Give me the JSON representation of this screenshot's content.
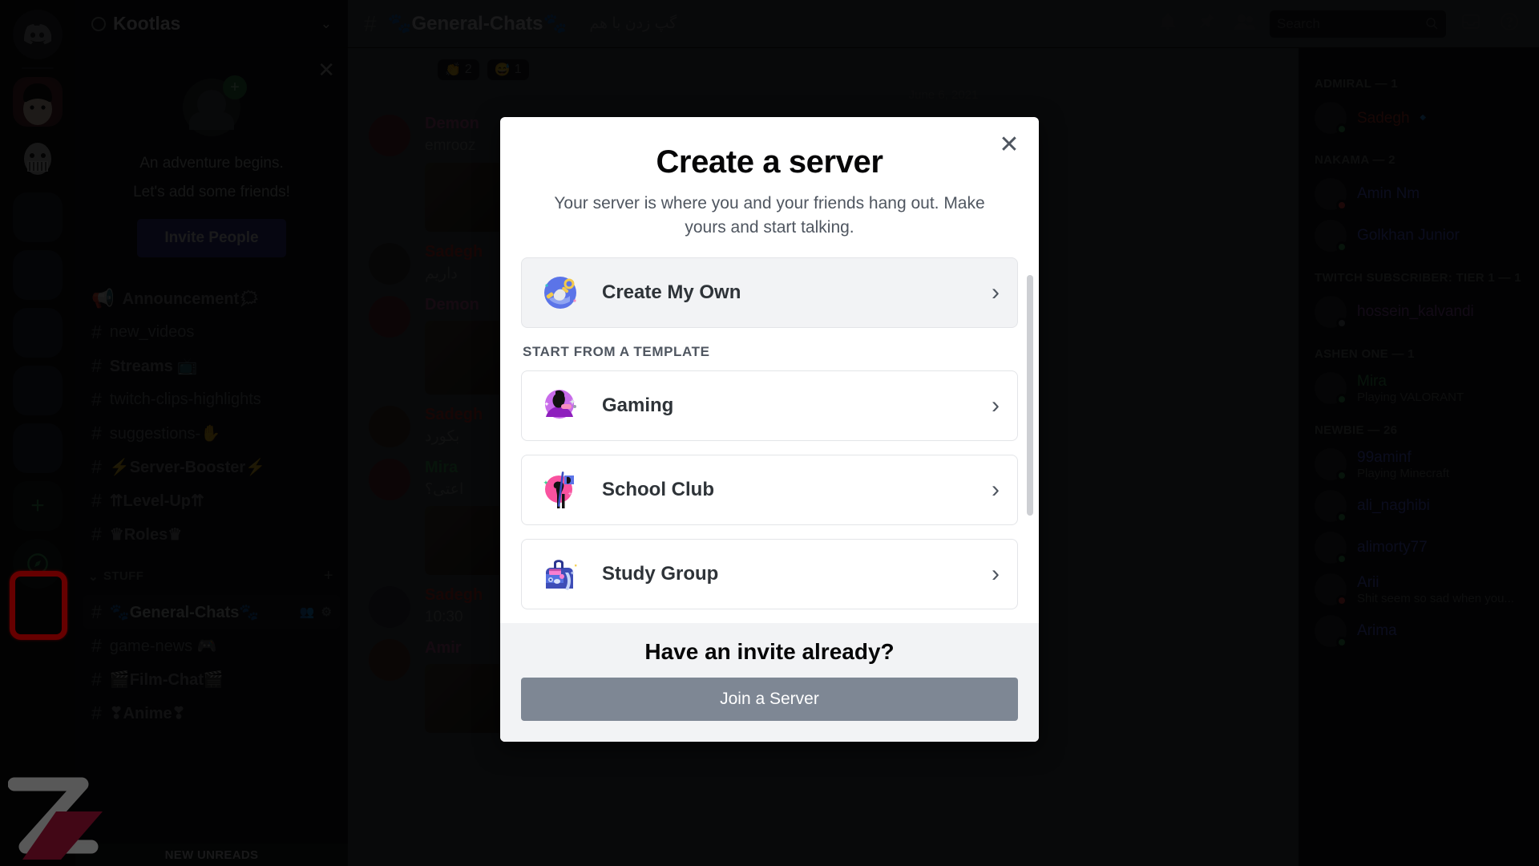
{
  "server": {
    "name": "Kootlas",
    "chevron": "⌄"
  },
  "friend_promo": {
    "line1": "An adventure begins.",
    "line2": "Let's add some friends!",
    "button": "Invite People",
    "close": "✕"
  },
  "channels": {
    "items": [
      {
        "icon": "📢",
        "name": "Announcement🗯",
        "bold": true,
        "active": false
      },
      {
        "icon": "#",
        "name": "new_videos",
        "bold": false,
        "active": false
      },
      {
        "icon": "#",
        "name": "Streams 📺",
        "bold": true,
        "active": false
      },
      {
        "icon": "#",
        "name": "twitch-clips-highlights",
        "bold": false,
        "active": false
      },
      {
        "icon": "#",
        "name": "suggestions-✋",
        "bold": false,
        "active": false
      },
      {
        "icon": "#",
        "name": "⚡Server-Booster⚡",
        "bold": true,
        "active": false
      },
      {
        "icon": "#",
        "name": "⇈Level-Up⇈",
        "bold": true,
        "active": false
      },
      {
        "icon": "#",
        "name": "♛Roles♛",
        "bold": true,
        "active": false
      }
    ],
    "category": {
      "label": "STUFF",
      "chevron": "⌄",
      "add": "+"
    },
    "stuff_items": [
      {
        "icon": "#",
        "name": "🐾General-Chats🐾",
        "bold": true,
        "active": true
      },
      {
        "icon": "#",
        "name": "game-news 🎮",
        "bold": false,
        "active": false
      },
      {
        "icon": "#",
        "name": "🎬Film-Chat🎬",
        "bold": true,
        "active": false
      },
      {
        "icon": "#",
        "name": "❣Anime❣",
        "bold": true,
        "active": false
      }
    ],
    "new_unreads": "NEW UNREADS"
  },
  "chat": {
    "hash": "#",
    "channel_name": "🐾General-Chats🐾",
    "topic": "گپ زدن با هم",
    "search_placeholder": "Search",
    "icons": {
      "bell": "bell-icon",
      "pin": "pin-icon",
      "members": "members-icon",
      "inbox": "inbox-icon",
      "help": "help-icon",
      "search": "search-icon"
    },
    "reactions": [
      {
        "emoji": "👏",
        "count": "2"
      },
      {
        "emoji": "😅",
        "count": "1"
      }
    ],
    "divider": "June 6, 2021",
    "messages": [
      {
        "author": "Demon",
        "color": "#b55b8e",
        "text": "emrooz"
      },
      {
        "author": "Sadegh",
        "color": "#c0392b",
        "text": "داریم"
      },
      {
        "author": "Demon",
        "color": "#b55b8e",
        "text": ""
      },
      {
        "author": "Sadegh",
        "color": "#c0392b",
        "text": "بکورد"
      },
      {
        "author": "Mira",
        "color": "#3ba55d",
        "text": "اعتی؟"
      },
      {
        "author": "Sadegh",
        "color": "#c0392b",
        "text": "10:30"
      },
      {
        "author": "Amir",
        "color": "#b55b8e",
        "text": ""
      }
    ]
  },
  "members": {
    "groups": [
      {
        "title": "ADMIRAL — 1",
        "rows": [
          {
            "name": "Sadegh 🔹",
            "color": "#c0392b",
            "status": "#3ba55d",
            "activity": ""
          }
        ]
      },
      {
        "title": "NAKAMA — 2",
        "rows": [
          {
            "name": "Amin Nm",
            "color": "#5865f2",
            "status": "#ed4245",
            "activity": ""
          },
          {
            "name": "Golkhan Junior",
            "color": "#5865f2",
            "status": "#3ba55d",
            "activity": ""
          }
        ]
      },
      {
        "title": "TWITCH SUBSCRIBER: TIER 1 — 1",
        "rows": [
          {
            "name": "hossein_kalvandi",
            "color": "#9b59b6",
            "status": "#747f8d",
            "activity": ""
          }
        ]
      },
      {
        "title": "ASHEN ONE — 1",
        "rows": [
          {
            "name": "Mira",
            "color": "#3ba55d",
            "status": "#3ba55d",
            "activity": "Playing VALORANT"
          }
        ]
      },
      {
        "title": "NEWBIE — 26",
        "rows": [
          {
            "name": "99aminf",
            "color": "#5865f2",
            "status": "#3ba55d",
            "activity": "Playing Minecraft"
          },
          {
            "name": "ali_naghibi",
            "color": "#5865f2",
            "status": "#3ba55d",
            "activity": ""
          },
          {
            "name": "alimorty77",
            "color": "#5865f2",
            "status": "#3ba55d",
            "activity": ""
          },
          {
            "name": "Arii",
            "color": "#5865f2",
            "status": "#ed4245",
            "activity": "Shit seem so sad when you..."
          },
          {
            "name": "Arima",
            "color": "#5865f2",
            "status": "#3ba55d",
            "activity": ""
          }
        ]
      }
    ]
  },
  "modal": {
    "close": "✕",
    "title": "Create a server",
    "subtitle": "Your server is where you and your friends hang out. Make yours and start talking.",
    "create_own": {
      "label": "Create My Own",
      "chevron": "›",
      "art": "globe-hand-icon"
    },
    "template_heading": "START FROM A TEMPLATE",
    "templates": [
      {
        "label": "Gaming",
        "chevron": "›",
        "art": "gaming-avatar-icon"
      },
      {
        "label": "School Club",
        "chevron": "›",
        "art": "flag-person-icon"
      },
      {
        "label": "Study Group",
        "chevron": "›",
        "art": "backpack-icon"
      }
    ],
    "footer": {
      "title": "Have an invite already?",
      "join_button": "Join a Server"
    }
  },
  "colors": {
    "accent": "#5865f2",
    "modal_bg": "#ffffff",
    "footer_bg": "#f2f3f5",
    "join_button": "#7e8794",
    "highlight_box": "#ff0000"
  }
}
